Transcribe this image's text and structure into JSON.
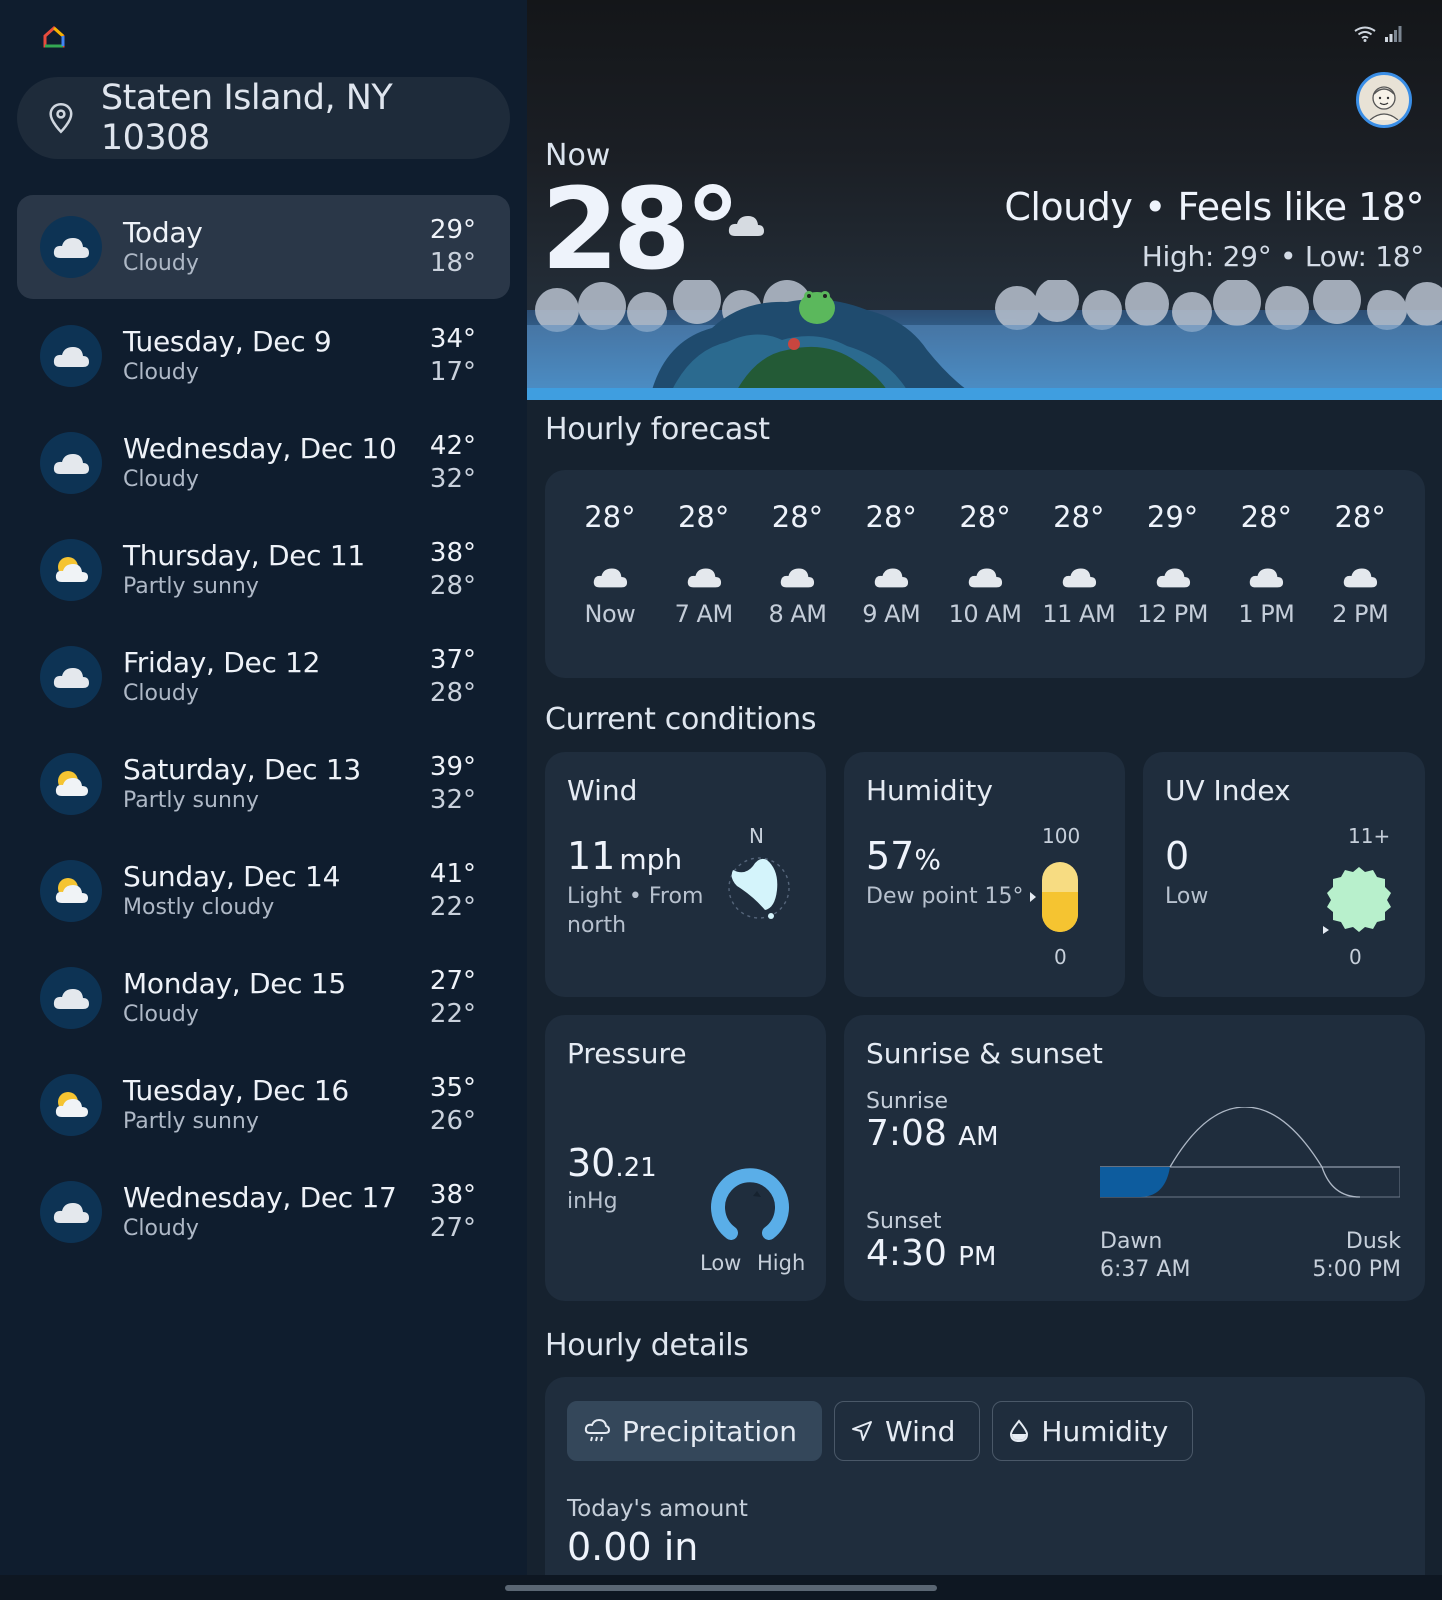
{
  "location": "Staten Island, NY 10308",
  "days": [
    {
      "name": "Today",
      "condition": "Cloudy",
      "high": "29°",
      "low": "18°",
      "icon": "cloud-icon"
    },
    {
      "name": "Tuesday, Dec 9",
      "condition": "Cloudy",
      "high": "34°",
      "low": "17°",
      "icon": "cloud-icon"
    },
    {
      "name": "Wednesday, Dec 10",
      "condition": "Cloudy",
      "high": "42°",
      "low": "32°",
      "icon": "cloud-icon"
    },
    {
      "name": "Thursday, Dec 11",
      "condition": "Partly sunny",
      "high": "38°",
      "low": "28°",
      "icon": "partly-sunny-icon"
    },
    {
      "name": "Friday, Dec 12",
      "condition": "Cloudy",
      "high": "37°",
      "low": "28°",
      "icon": "cloud-icon"
    },
    {
      "name": "Saturday, Dec 13",
      "condition": "Partly sunny",
      "high": "39°",
      "low": "32°",
      "icon": "partly-sunny-icon"
    },
    {
      "name": "Sunday, Dec 14",
      "condition": "Mostly cloudy",
      "high": "41°",
      "low": "22°",
      "icon": "partly-sunny-icon"
    },
    {
      "name": "Monday, Dec 15",
      "condition": "Cloudy",
      "high": "27°",
      "low": "22°",
      "icon": "cloud-icon"
    },
    {
      "name": "Tuesday, Dec 16",
      "condition": "Partly sunny",
      "high": "35°",
      "low": "26°",
      "icon": "partly-sunny-icon"
    },
    {
      "name": "Wednesday, Dec 17",
      "condition": "Cloudy",
      "high": "38°",
      "low": "27°",
      "icon": "cloud-icon"
    }
  ],
  "now": {
    "label": "Now",
    "temp": "28°",
    "summary": "Cloudy • Feels like 18°",
    "highlow": "High: 29° • Low: 18°"
  },
  "hourly": {
    "title": "Hourly forecast",
    "items": [
      {
        "temp": "28°",
        "label": "Now"
      },
      {
        "temp": "28°",
        "label": "7 AM"
      },
      {
        "temp": "28°",
        "label": "8 AM"
      },
      {
        "temp": "28°",
        "label": "9 AM"
      },
      {
        "temp": "28°",
        "label": "10 AM"
      },
      {
        "temp": "28°",
        "label": "11 AM"
      },
      {
        "temp": "29°",
        "label": "12 PM"
      },
      {
        "temp": "28°",
        "label": "1 PM"
      },
      {
        "temp": "28°",
        "label": "2 PM"
      }
    ]
  },
  "conditions": {
    "title": "Current conditions",
    "wind": {
      "title": "Wind",
      "value": "11",
      "unit": "mph",
      "desc": "Light • From north",
      "dir": "N"
    },
    "humidity": {
      "title": "Humidity",
      "value": "57",
      "unit": "%",
      "dew": "Dew point 15°",
      "max": "100",
      "min": "0",
      "level": 0.57
    },
    "uv": {
      "title": "UV Index",
      "value": "0",
      "desc": "Low",
      "max": "11+",
      "min": "0"
    },
    "pressure": {
      "title": "Pressure",
      "value": "30",
      "decimal": ".21",
      "unit": "inHg",
      "low": "Low",
      "high": "High"
    },
    "sun": {
      "title": "Sunrise & sunset",
      "sunrise_label": "Sunrise",
      "sunrise": "7:08",
      "sunrise_ampm": "AM",
      "sunset_label": "Sunset",
      "sunset": "4:30",
      "sunset_ampm": "PM",
      "dawn_label": "Dawn",
      "dawn": "6:37 AM",
      "dusk_label": "Dusk",
      "dusk": "5:00 PM"
    }
  },
  "details": {
    "title": "Hourly details",
    "tabs": [
      "Precipitation",
      "Wind",
      "Humidity"
    ],
    "amount_label": "Today's amount",
    "amount": "0.00 in"
  },
  "colors": {
    "accent": "#0d5c9e",
    "humidity_fill": "#f5c431",
    "uv_fill": "#b8f0cc",
    "wind_fill": "#d4f4fb"
  }
}
